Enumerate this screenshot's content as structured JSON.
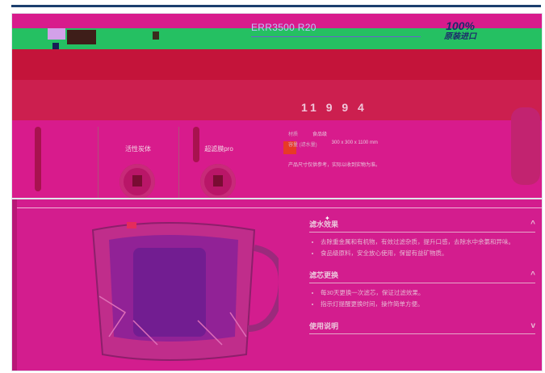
{
  "header": {
    "model_label": "ERR3500 R20",
    "promo_big": "100%",
    "promo_small": "原装进口"
  },
  "hero": {
    "title": "11 9 9 4",
    "features": [
      {
        "label": "活性炭体"
      },
      {
        "label": "超滤膜pro"
      }
    ],
    "specs": {
      "r1_label": "材质",
      "r1_value": "食品级",
      "r2_label": "容量 (滤水量)",
      "r2_value": "300 x 300 x 1100 mm",
      "note": "产品尺寸仅供参考，实际以收到实物为准。"
    }
  },
  "accordion": [
    {
      "title": "滤水效果",
      "chevron": "^",
      "bullets": [
        "去除重金属和有机物，有效过滤杂质，提升口感，去除水中余氯和异味。",
        "食品级原料，安全放心使用，保留有益矿物质。"
      ]
    },
    {
      "title": "滤芯更换",
      "chevron": "^",
      "bullets": [
        "每30天更换一次滤芯，保证过滤效果。",
        "指示灯提醒更换时间，操作简单方便。"
      ]
    },
    {
      "title": "使用说明",
      "chevron": "v",
      "bullets": []
    }
  ],
  "colors": {
    "magenta": "#d81b8c",
    "green": "#25c062",
    "navy": "#1c3f6e"
  }
}
